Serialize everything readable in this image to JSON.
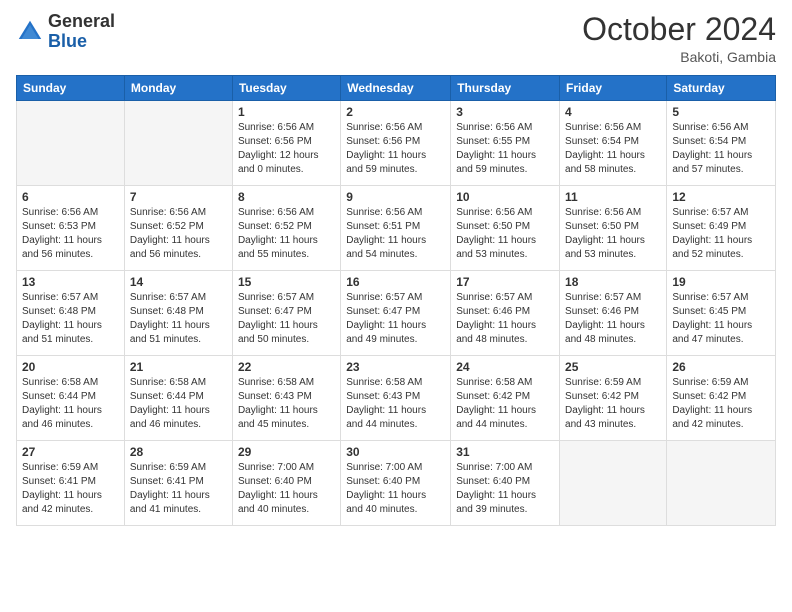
{
  "header": {
    "logo_line1": "General",
    "logo_line2": "Blue",
    "month": "October 2024",
    "location": "Bakoti, Gambia"
  },
  "days_of_week": [
    "Sunday",
    "Monday",
    "Tuesday",
    "Wednesday",
    "Thursday",
    "Friday",
    "Saturday"
  ],
  "weeks": [
    [
      {
        "day": "",
        "sunrise": "",
        "sunset": "",
        "daylight": "",
        "empty": true
      },
      {
        "day": "",
        "sunrise": "",
        "sunset": "",
        "daylight": "",
        "empty": true
      },
      {
        "day": "1",
        "sunrise": "Sunrise: 6:56 AM",
        "sunset": "Sunset: 6:56 PM",
        "daylight": "Daylight: 12 hours and 0 minutes."
      },
      {
        "day": "2",
        "sunrise": "Sunrise: 6:56 AM",
        "sunset": "Sunset: 6:56 PM",
        "daylight": "Daylight: 11 hours and 59 minutes."
      },
      {
        "day": "3",
        "sunrise": "Sunrise: 6:56 AM",
        "sunset": "Sunset: 6:55 PM",
        "daylight": "Daylight: 11 hours and 59 minutes."
      },
      {
        "day": "4",
        "sunrise": "Sunrise: 6:56 AM",
        "sunset": "Sunset: 6:54 PM",
        "daylight": "Daylight: 11 hours and 58 minutes."
      },
      {
        "day": "5",
        "sunrise": "Sunrise: 6:56 AM",
        "sunset": "Sunset: 6:54 PM",
        "daylight": "Daylight: 11 hours and 57 minutes."
      }
    ],
    [
      {
        "day": "6",
        "sunrise": "Sunrise: 6:56 AM",
        "sunset": "Sunset: 6:53 PM",
        "daylight": "Daylight: 11 hours and 56 minutes."
      },
      {
        "day": "7",
        "sunrise": "Sunrise: 6:56 AM",
        "sunset": "Sunset: 6:52 PM",
        "daylight": "Daylight: 11 hours and 56 minutes."
      },
      {
        "day": "8",
        "sunrise": "Sunrise: 6:56 AM",
        "sunset": "Sunset: 6:52 PM",
        "daylight": "Daylight: 11 hours and 55 minutes."
      },
      {
        "day": "9",
        "sunrise": "Sunrise: 6:56 AM",
        "sunset": "Sunset: 6:51 PM",
        "daylight": "Daylight: 11 hours and 54 minutes."
      },
      {
        "day": "10",
        "sunrise": "Sunrise: 6:56 AM",
        "sunset": "Sunset: 6:50 PM",
        "daylight": "Daylight: 11 hours and 53 minutes."
      },
      {
        "day": "11",
        "sunrise": "Sunrise: 6:56 AM",
        "sunset": "Sunset: 6:50 PM",
        "daylight": "Daylight: 11 hours and 53 minutes."
      },
      {
        "day": "12",
        "sunrise": "Sunrise: 6:57 AM",
        "sunset": "Sunset: 6:49 PM",
        "daylight": "Daylight: 11 hours and 52 minutes."
      }
    ],
    [
      {
        "day": "13",
        "sunrise": "Sunrise: 6:57 AM",
        "sunset": "Sunset: 6:48 PM",
        "daylight": "Daylight: 11 hours and 51 minutes."
      },
      {
        "day": "14",
        "sunrise": "Sunrise: 6:57 AM",
        "sunset": "Sunset: 6:48 PM",
        "daylight": "Daylight: 11 hours and 51 minutes."
      },
      {
        "day": "15",
        "sunrise": "Sunrise: 6:57 AM",
        "sunset": "Sunset: 6:47 PM",
        "daylight": "Daylight: 11 hours and 50 minutes."
      },
      {
        "day": "16",
        "sunrise": "Sunrise: 6:57 AM",
        "sunset": "Sunset: 6:47 PM",
        "daylight": "Daylight: 11 hours and 49 minutes."
      },
      {
        "day": "17",
        "sunrise": "Sunrise: 6:57 AM",
        "sunset": "Sunset: 6:46 PM",
        "daylight": "Daylight: 11 hours and 48 minutes."
      },
      {
        "day": "18",
        "sunrise": "Sunrise: 6:57 AM",
        "sunset": "Sunset: 6:46 PM",
        "daylight": "Daylight: 11 hours and 48 minutes."
      },
      {
        "day": "19",
        "sunrise": "Sunrise: 6:57 AM",
        "sunset": "Sunset: 6:45 PM",
        "daylight": "Daylight: 11 hours and 47 minutes."
      }
    ],
    [
      {
        "day": "20",
        "sunrise": "Sunrise: 6:58 AM",
        "sunset": "Sunset: 6:44 PM",
        "daylight": "Daylight: 11 hours and 46 minutes."
      },
      {
        "day": "21",
        "sunrise": "Sunrise: 6:58 AM",
        "sunset": "Sunset: 6:44 PM",
        "daylight": "Daylight: 11 hours and 46 minutes."
      },
      {
        "day": "22",
        "sunrise": "Sunrise: 6:58 AM",
        "sunset": "Sunset: 6:43 PM",
        "daylight": "Daylight: 11 hours and 45 minutes."
      },
      {
        "day": "23",
        "sunrise": "Sunrise: 6:58 AM",
        "sunset": "Sunset: 6:43 PM",
        "daylight": "Daylight: 11 hours and 44 minutes."
      },
      {
        "day": "24",
        "sunrise": "Sunrise: 6:58 AM",
        "sunset": "Sunset: 6:42 PM",
        "daylight": "Daylight: 11 hours and 44 minutes."
      },
      {
        "day": "25",
        "sunrise": "Sunrise: 6:59 AM",
        "sunset": "Sunset: 6:42 PM",
        "daylight": "Daylight: 11 hours and 43 minutes."
      },
      {
        "day": "26",
        "sunrise": "Sunrise: 6:59 AM",
        "sunset": "Sunset: 6:42 PM",
        "daylight": "Daylight: 11 hours and 42 minutes."
      }
    ],
    [
      {
        "day": "27",
        "sunrise": "Sunrise: 6:59 AM",
        "sunset": "Sunset: 6:41 PM",
        "daylight": "Daylight: 11 hours and 42 minutes."
      },
      {
        "day": "28",
        "sunrise": "Sunrise: 6:59 AM",
        "sunset": "Sunset: 6:41 PM",
        "daylight": "Daylight: 11 hours and 41 minutes."
      },
      {
        "day": "29",
        "sunrise": "Sunrise: 7:00 AM",
        "sunset": "Sunset: 6:40 PM",
        "daylight": "Daylight: 11 hours and 40 minutes."
      },
      {
        "day": "30",
        "sunrise": "Sunrise: 7:00 AM",
        "sunset": "Sunset: 6:40 PM",
        "daylight": "Daylight: 11 hours and 40 minutes."
      },
      {
        "day": "31",
        "sunrise": "Sunrise: 7:00 AM",
        "sunset": "Sunset: 6:40 PM",
        "daylight": "Daylight: 11 hours and 39 minutes."
      },
      {
        "day": "",
        "sunrise": "",
        "sunset": "",
        "daylight": "",
        "empty": true
      },
      {
        "day": "",
        "sunrise": "",
        "sunset": "",
        "daylight": "",
        "empty": true
      }
    ]
  ]
}
